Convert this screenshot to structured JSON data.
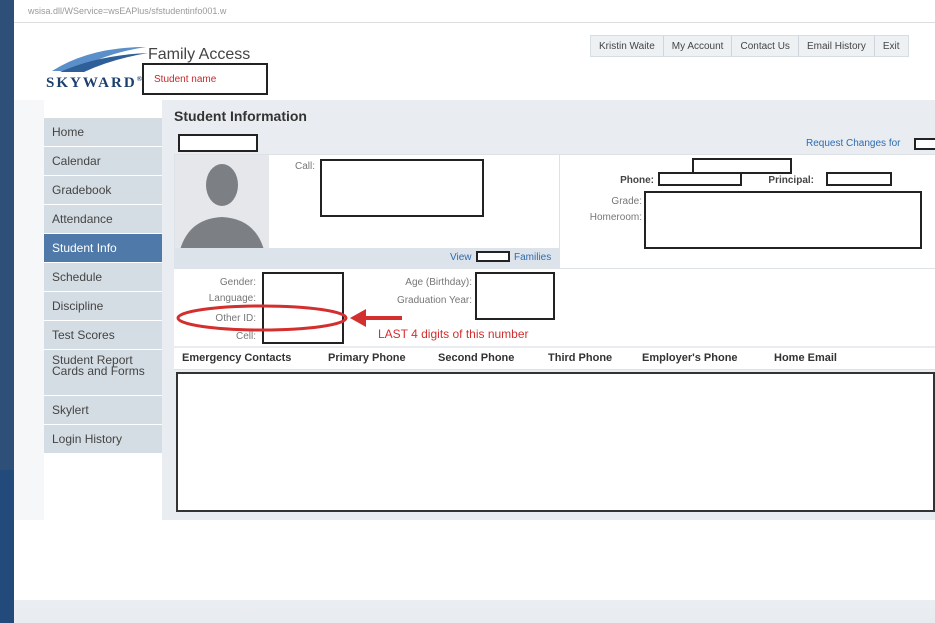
{
  "app": {
    "url": "wsisa.dll/WService=wsEAPlus/sfstudentinfo001.w",
    "logo": "SKYWARD",
    "logo_mark": "®",
    "title": "Family Access",
    "student_name_placeholder": "Student name"
  },
  "topnav": [
    "Kristin Waite",
    "My Account",
    "Contact Us",
    "Email History",
    "Exit"
  ],
  "sidebar": {
    "items": [
      {
        "label": "Home"
      },
      {
        "label": "Calendar"
      },
      {
        "label": "Gradebook"
      },
      {
        "label": "Attendance"
      },
      {
        "label": "Student Info",
        "active": true
      },
      {
        "label": "Schedule"
      },
      {
        "label": "Discipline"
      },
      {
        "label": "Test Scores"
      },
      {
        "label": "Student Report Cards and Forms"
      },
      {
        "label": "Skylert"
      },
      {
        "label": "Login History"
      }
    ]
  },
  "main": {
    "section_title": "Student Information",
    "request_changes": "Request Changes for",
    "photo_labels": {
      "call": "Call:",
      "view": "View",
      "families": "Families"
    },
    "info_labels": {
      "phone": "Phone:",
      "principal": "Principal:",
      "grade": "Grade:",
      "homeroom": "Homeroom:"
    },
    "detail_labels": {
      "gender": "Gender:",
      "language": "Language:",
      "other_id": "Other ID:",
      "cell": "Cell:",
      "age": "Age (Birthday):",
      "graduation": "Graduation Year:"
    },
    "annotation": "LAST 4 digits of this number",
    "table_headers": [
      "Emergency Contacts",
      "Primary Phone",
      "Second Phone",
      "Third Phone",
      "Employer's Phone",
      "Home Email"
    ]
  },
  "colors": {
    "accent": "#4f79a8",
    "link": "#2d6bb0",
    "annotation": "#d32f2f",
    "brand": "#1c3f6e"
  }
}
